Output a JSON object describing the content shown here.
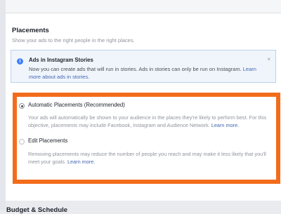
{
  "placements": {
    "title": "Placements",
    "subtitle": "Show your ads to the right people in the right places."
  },
  "info": {
    "icon": "info-icon",
    "title": "Ads in Instagram Stories",
    "close": "×",
    "text": "Now you can create ads that will run in stories. Ads in stories can only be run on Instagram.",
    "link": "Learn more about ads in stories."
  },
  "options": {
    "automatic": {
      "selected": true,
      "label": "Automatic Placements (Recommended)",
      "desc": "Your ads will automatically be shown to your audience in the places they're likely to perform best. For this objective, placements may include Facebook, Instagram and Audience Network.",
      "link": "Learn more."
    },
    "edit": {
      "selected": false,
      "label": "Edit Placements",
      "desc": "Removing placements may reduce the number of people you reach and may make it less likely that you'll meet your goals.",
      "link": "Learn more."
    }
  },
  "next_section": {
    "title": "Budget & Schedule"
  },
  "colors": {
    "highlight": "#f26c1b",
    "link": "#4267b2",
    "info_bg": "#f0f5fc"
  }
}
